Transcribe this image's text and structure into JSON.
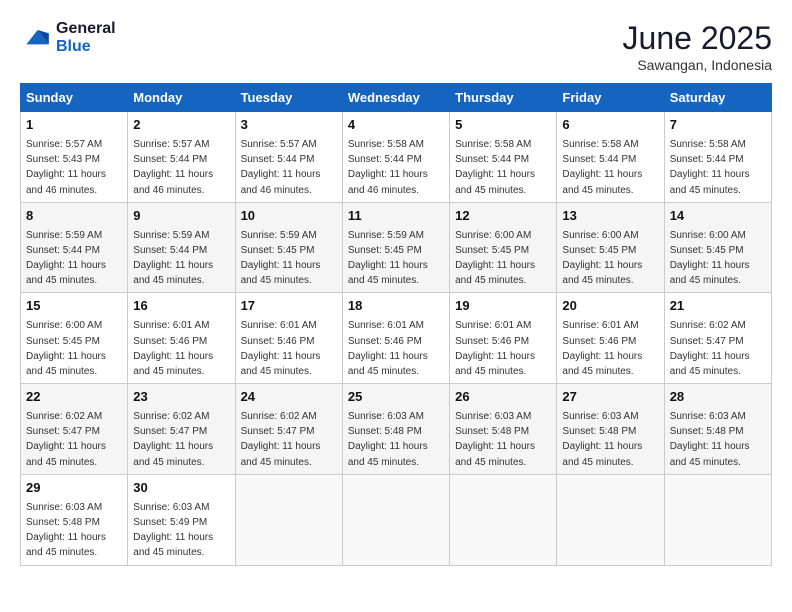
{
  "header": {
    "logo_line1": "General",
    "logo_line2": "Blue",
    "month": "June 2025",
    "location": "Sawangan, Indonesia"
  },
  "days_of_week": [
    "Sunday",
    "Monday",
    "Tuesday",
    "Wednesday",
    "Thursday",
    "Friday",
    "Saturday"
  ],
  "weeks": [
    [
      {
        "day": 1,
        "sunrise": "5:57 AM",
        "sunset": "5:43 PM",
        "daylight": "11 hours and 46 minutes."
      },
      {
        "day": 2,
        "sunrise": "5:57 AM",
        "sunset": "5:44 PM",
        "daylight": "11 hours and 46 minutes."
      },
      {
        "day": 3,
        "sunrise": "5:57 AM",
        "sunset": "5:44 PM",
        "daylight": "11 hours and 46 minutes."
      },
      {
        "day": 4,
        "sunrise": "5:58 AM",
        "sunset": "5:44 PM",
        "daylight": "11 hours and 46 minutes."
      },
      {
        "day": 5,
        "sunrise": "5:58 AM",
        "sunset": "5:44 PM",
        "daylight": "11 hours and 45 minutes."
      },
      {
        "day": 6,
        "sunrise": "5:58 AM",
        "sunset": "5:44 PM",
        "daylight": "11 hours and 45 minutes."
      },
      {
        "day": 7,
        "sunrise": "5:58 AM",
        "sunset": "5:44 PM",
        "daylight": "11 hours and 45 minutes."
      }
    ],
    [
      {
        "day": 8,
        "sunrise": "5:59 AM",
        "sunset": "5:44 PM",
        "daylight": "11 hours and 45 minutes."
      },
      {
        "day": 9,
        "sunrise": "5:59 AM",
        "sunset": "5:44 PM",
        "daylight": "11 hours and 45 minutes."
      },
      {
        "day": 10,
        "sunrise": "5:59 AM",
        "sunset": "5:45 PM",
        "daylight": "11 hours and 45 minutes."
      },
      {
        "day": 11,
        "sunrise": "5:59 AM",
        "sunset": "5:45 PM",
        "daylight": "11 hours and 45 minutes."
      },
      {
        "day": 12,
        "sunrise": "6:00 AM",
        "sunset": "5:45 PM",
        "daylight": "11 hours and 45 minutes."
      },
      {
        "day": 13,
        "sunrise": "6:00 AM",
        "sunset": "5:45 PM",
        "daylight": "11 hours and 45 minutes."
      },
      {
        "day": 14,
        "sunrise": "6:00 AM",
        "sunset": "5:45 PM",
        "daylight": "11 hours and 45 minutes."
      }
    ],
    [
      {
        "day": 15,
        "sunrise": "6:00 AM",
        "sunset": "5:45 PM",
        "daylight": "11 hours and 45 minutes."
      },
      {
        "day": 16,
        "sunrise": "6:01 AM",
        "sunset": "5:46 PM",
        "daylight": "11 hours and 45 minutes."
      },
      {
        "day": 17,
        "sunrise": "6:01 AM",
        "sunset": "5:46 PM",
        "daylight": "11 hours and 45 minutes."
      },
      {
        "day": 18,
        "sunrise": "6:01 AM",
        "sunset": "5:46 PM",
        "daylight": "11 hours and 45 minutes."
      },
      {
        "day": 19,
        "sunrise": "6:01 AM",
        "sunset": "5:46 PM",
        "daylight": "11 hours and 45 minutes."
      },
      {
        "day": 20,
        "sunrise": "6:01 AM",
        "sunset": "5:46 PM",
        "daylight": "11 hours and 45 minutes."
      },
      {
        "day": 21,
        "sunrise": "6:02 AM",
        "sunset": "5:47 PM",
        "daylight": "11 hours and 45 minutes."
      }
    ],
    [
      {
        "day": 22,
        "sunrise": "6:02 AM",
        "sunset": "5:47 PM",
        "daylight": "11 hours and 45 minutes."
      },
      {
        "day": 23,
        "sunrise": "6:02 AM",
        "sunset": "5:47 PM",
        "daylight": "11 hours and 45 minutes."
      },
      {
        "day": 24,
        "sunrise": "6:02 AM",
        "sunset": "5:47 PM",
        "daylight": "11 hours and 45 minutes."
      },
      {
        "day": 25,
        "sunrise": "6:03 AM",
        "sunset": "5:48 PM",
        "daylight": "11 hours and 45 minutes."
      },
      {
        "day": 26,
        "sunrise": "6:03 AM",
        "sunset": "5:48 PM",
        "daylight": "11 hours and 45 minutes."
      },
      {
        "day": 27,
        "sunrise": "6:03 AM",
        "sunset": "5:48 PM",
        "daylight": "11 hours and 45 minutes."
      },
      {
        "day": 28,
        "sunrise": "6:03 AM",
        "sunset": "5:48 PM",
        "daylight": "11 hours and 45 minutes."
      }
    ],
    [
      {
        "day": 29,
        "sunrise": "6:03 AM",
        "sunset": "5:48 PM",
        "daylight": "11 hours and 45 minutes."
      },
      {
        "day": 30,
        "sunrise": "6:03 AM",
        "sunset": "5:49 PM",
        "daylight": "11 hours and 45 minutes."
      },
      null,
      null,
      null,
      null,
      null
    ]
  ]
}
